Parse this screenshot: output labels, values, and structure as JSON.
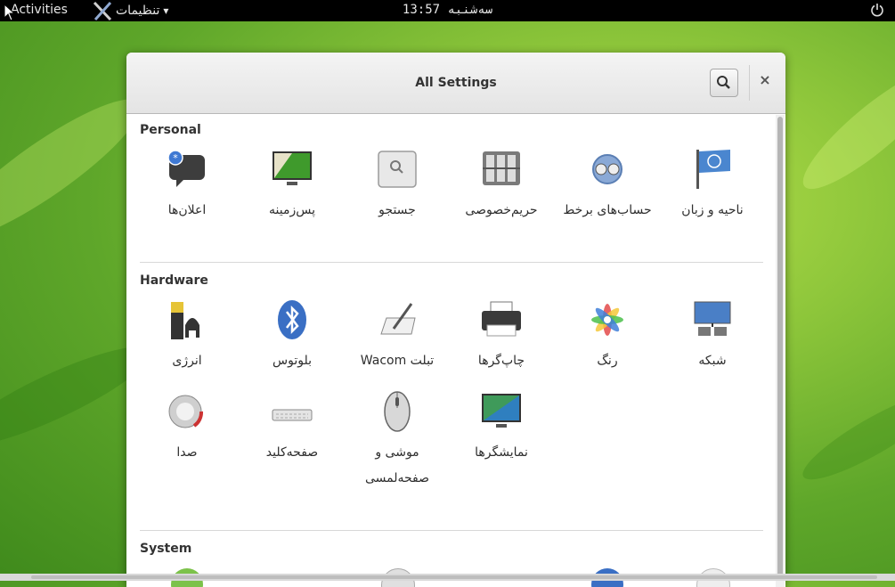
{
  "topbar": {
    "activities": "Activities",
    "app_menu_label": "تنظیمات",
    "app_menu_arrow": "▾",
    "clock": "سه‌شنبه 13:57",
    "power_icon": "power-icon"
  },
  "window": {
    "title": "All Settings",
    "search_icon": "search-icon",
    "close_label": "×"
  },
  "sections": {
    "personal": {
      "title": "Personal",
      "items": [
        {
          "label": "ناحیه و زبان",
          "icon": "flag-icon"
        },
        {
          "label": "حساب‌های برخط",
          "icon": "online-accounts-icon"
        },
        {
          "label": "حریم‌خصوصی",
          "icon": "privacy-lock-icon"
        },
        {
          "label": "جستجو",
          "icon": "search-settings-icon"
        },
        {
          "label": "پس‌زمینه",
          "icon": "background-monitor-icon"
        },
        {
          "label": "اعلان‌ها",
          "icon": "notifications-icon"
        }
      ]
    },
    "hardware": {
      "title": "Hardware",
      "items": [
        {
          "label": "شبکه",
          "icon": "network-icon"
        },
        {
          "label": "رنگ",
          "icon": "color-icon"
        },
        {
          "label": "چاپ‌گرها",
          "icon": "printer-icon"
        },
        {
          "label": "تبلت Wacom",
          "icon": "wacom-tablet-icon"
        },
        {
          "label": "بلوتوس",
          "icon": "bluetooth-icon"
        },
        {
          "label": "انرژی",
          "icon": "power-battery-icon"
        },
        {
          "label": "نمایشگرها",
          "icon": "displays-icon"
        },
        {
          "label": "موشی و صفحه‌لمسی",
          "icon": "mouse-icon"
        },
        {
          "label": "صفحه‌کلید",
          "icon": "keyboard-icon"
        },
        {
          "label": "صدا",
          "icon": "sound-icon"
        }
      ]
    },
    "system": {
      "title": "System"
    }
  },
  "colors": {
    "topbar_bg": "#000000",
    "desktop_green": "#7ab834",
    "header_bg": "#e8e8e8"
  }
}
